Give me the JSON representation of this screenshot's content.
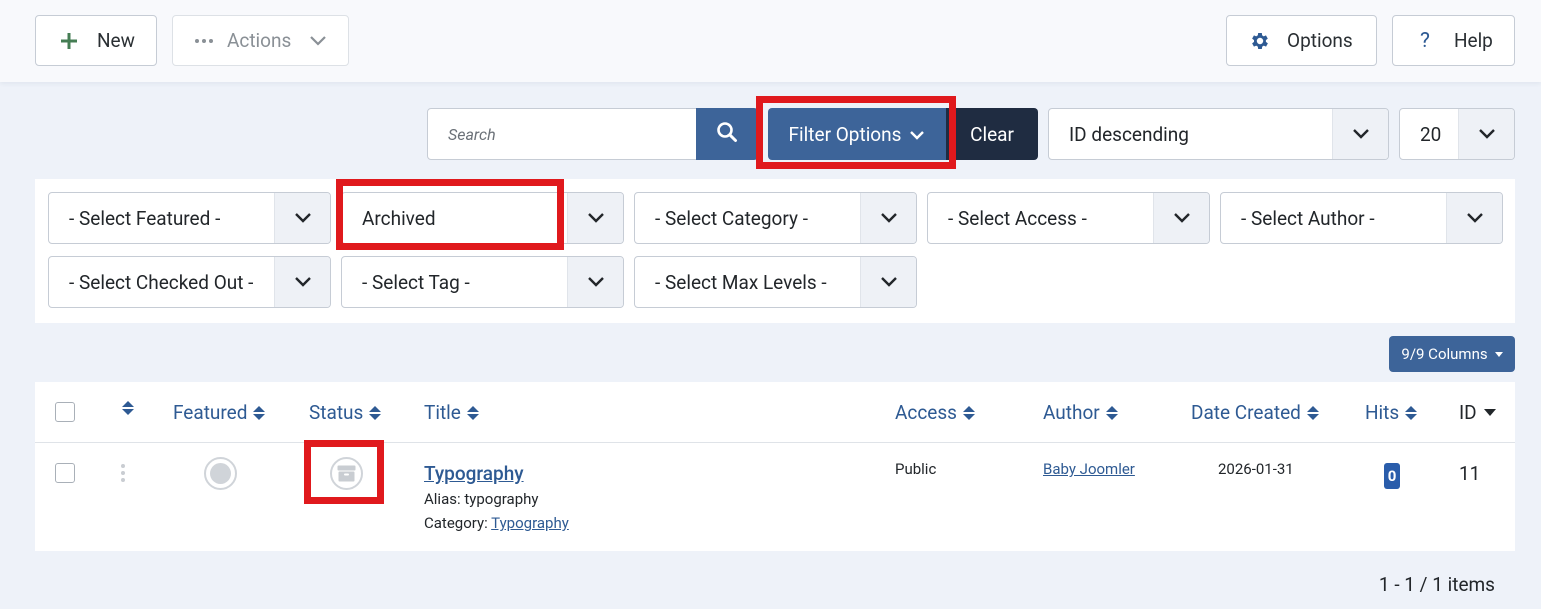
{
  "toolbar": {
    "new_label": "New",
    "actions_label": "Actions",
    "options_label": "Options",
    "help_label": "Help"
  },
  "search": {
    "placeholder": "Search"
  },
  "filter_options_label": "Filter Options",
  "clear_label": "Clear",
  "sort": {
    "selected": "ID descending"
  },
  "limit": {
    "selected": "20"
  },
  "filters": {
    "featured": "- Select Featured -",
    "status": "Archived",
    "category": "- Select Category -",
    "access": "- Select Access -",
    "author": "- Select Author -",
    "checked_out": "- Select Checked Out -",
    "tag": "- Select Tag -",
    "max_levels": "- Select Max Levels -"
  },
  "columns_button": "9/9 Columns",
  "table": {
    "headers": {
      "featured": "Featured",
      "status": "Status",
      "title": "Title",
      "access": "Access",
      "author": "Author",
      "date_created": "Date Created",
      "hits": "Hits",
      "id": "ID"
    },
    "rows": [
      {
        "title": "Typography",
        "alias_label": "Alias:",
        "alias": "typography",
        "category_label": "Category:",
        "category": "Typography",
        "access": "Public",
        "author": "Baby Joomler",
        "date_created": "2026-01-31",
        "hits": "0",
        "id": "11",
        "status_icon": "archive-icon",
        "featured_icon": "unfeatured-circle-icon"
      }
    ]
  },
  "pagination": "1 - 1 / 1 items",
  "colors": {
    "primary": "#3d6499",
    "dark": "#1f2c41",
    "highlight": "#e0191d",
    "link": "#2e5a93"
  }
}
